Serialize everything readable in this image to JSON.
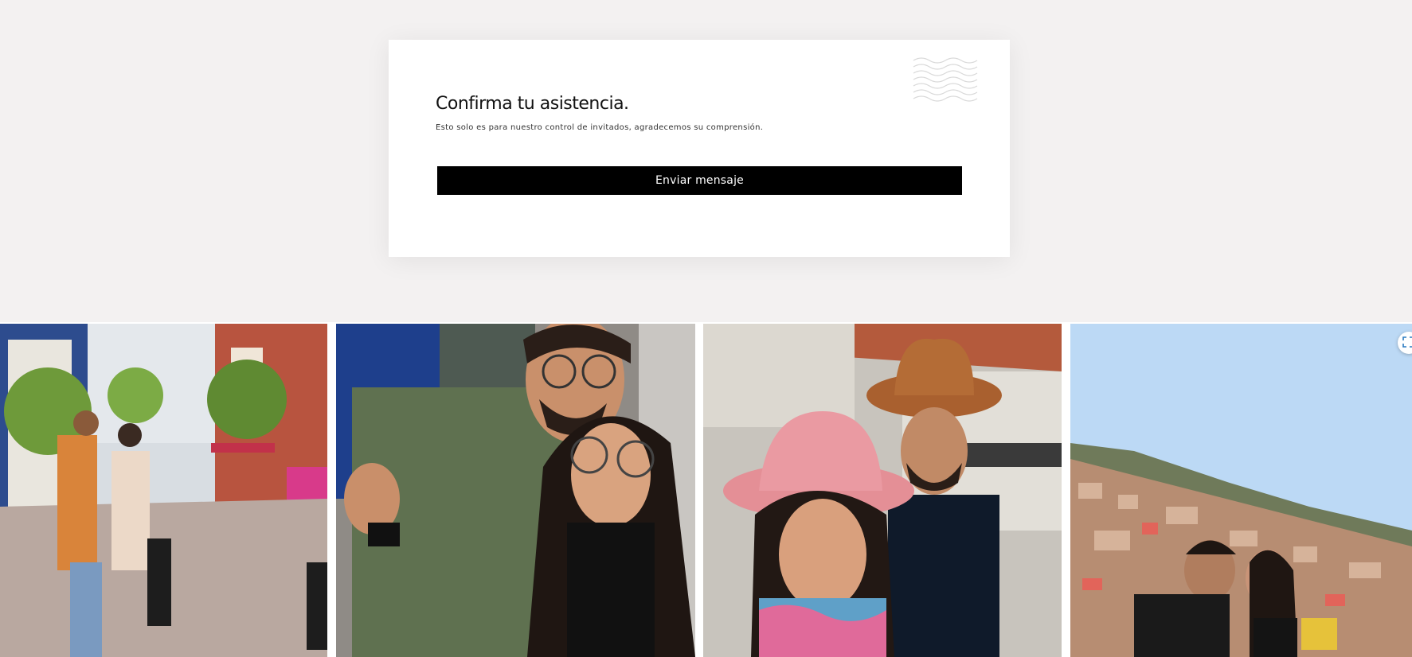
{
  "rsvp": {
    "title": "Confirma tu asistencia.",
    "subtitle": "Esto solo es para nuestro control de invitados, agradecemos su comprensión.",
    "button_label": "Enviar mensaje"
  },
  "gallery": {
    "photos": [
      {
        "icon": "photo-couple-street"
      },
      {
        "icon": "photo-couple-selfie"
      },
      {
        "icon": "photo-couple-cowboy-hats"
      },
      {
        "icon": "photo-couple-city-view"
      }
    ],
    "expand_icon": "expand-icon"
  },
  "colors": {
    "background": "#f3f1f1",
    "card": "#ffffff",
    "button": "#000000",
    "button_text": "#ffffff"
  }
}
